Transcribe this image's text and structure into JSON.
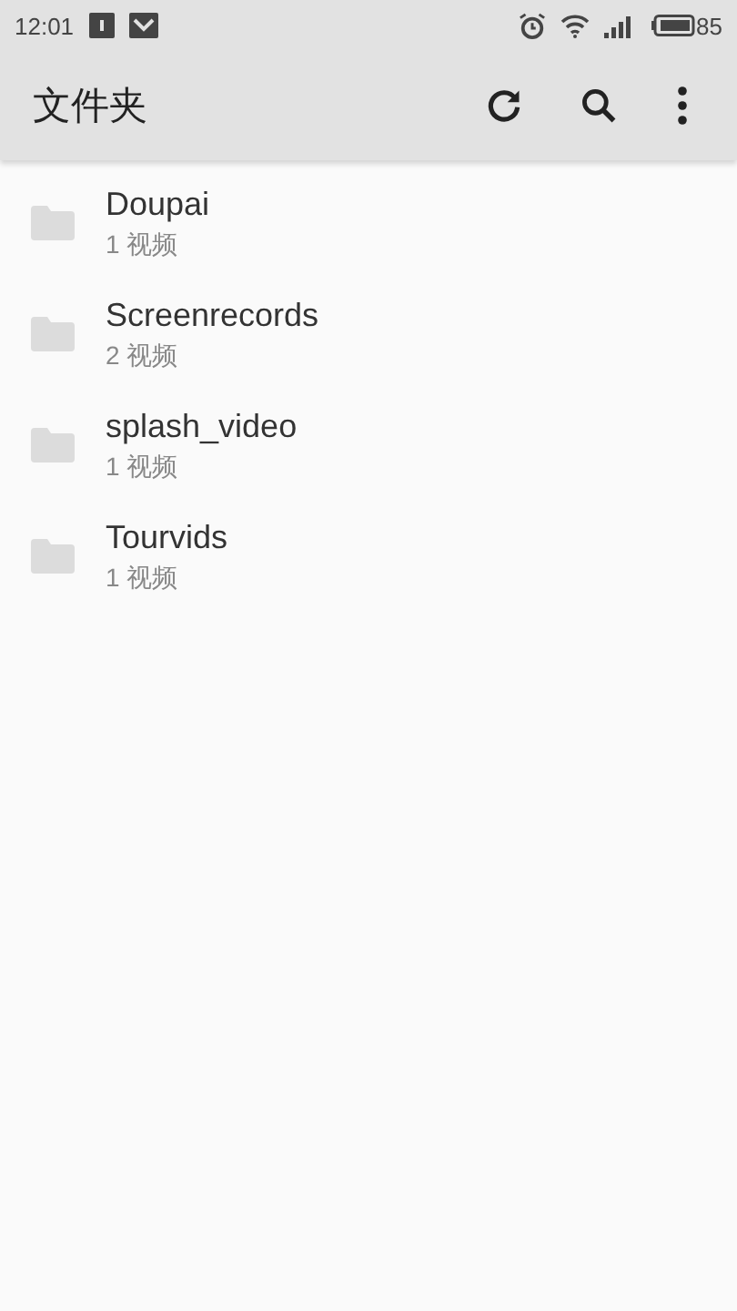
{
  "status_bar": {
    "time": "12:01",
    "battery_percent": "85"
  },
  "app_bar": {
    "title": "文件夹"
  },
  "folders": [
    {
      "name": "Doupai",
      "count": "1 视频"
    },
    {
      "name": "Screenrecords",
      "count": "2 视频"
    },
    {
      "name": "splash_video",
      "count": "1 视频"
    },
    {
      "name": "Tourvids",
      "count": "1 视频"
    }
  ]
}
